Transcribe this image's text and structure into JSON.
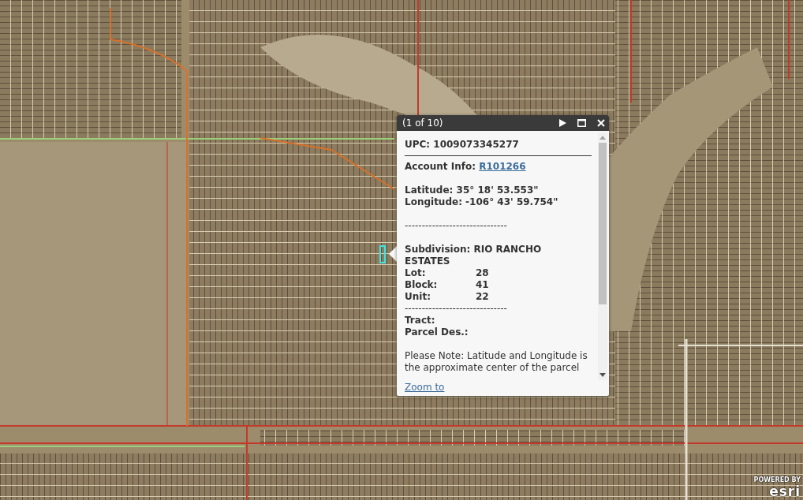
{
  "popup": {
    "counter": "(1 of 10)",
    "upc": "UPC: 1009073345277",
    "account": {
      "label": "Account Info:",
      "link": "R101266"
    },
    "latitude": "Latitude: 35° 18' 53.553\"",
    "longitude": "Longitude: -106° 43' 59.754\"",
    "separator": "------------------------------",
    "subdivision": [
      "Subdivision: RIO RANCHO",
      "ESTATES"
    ],
    "parcel_fields": [
      {
        "label": "Lot:",
        "value": "28"
      },
      {
        "label": "Block:",
        "value": "41"
      },
      {
        "label": "Unit:",
        "value": "22"
      }
    ],
    "separator_2": "------------------------------",
    "extra_fields": [
      {
        "label": "Tract:"
      },
      {
        "label": "Parcel Des.:"
      }
    ],
    "note": [
      "Please Note: Latitude and Longitude is",
      "the approximate center of the parcel"
    ],
    "zoom_link": "Zoom to"
  },
  "attribution": {
    "label": "POWERED BY",
    "logo": "esri"
  }
}
